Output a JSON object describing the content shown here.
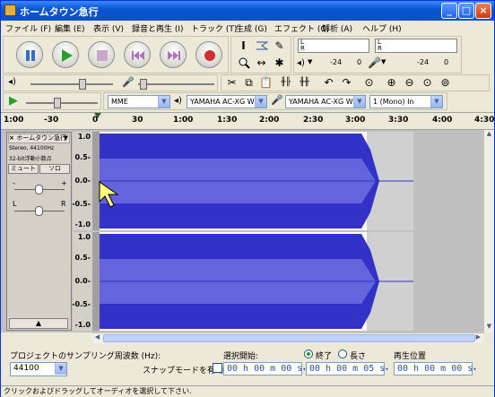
{
  "window": {
    "title": "ホームタウン急行"
  },
  "menu": [
    "ファイル (F)",
    "編集 (E)",
    "表示 (V)",
    "録音と再生 (I)",
    "トラック (T)",
    "生成 (G)",
    "エフェクト (C)",
    "解析 (A)",
    "ヘルプ (H)"
  ],
  "meters": {
    "l": "L",
    "r": "R",
    "ticks": [
      "-24",
      "0",
      "-24",
      "0"
    ]
  },
  "devices": {
    "host": "MME",
    "playback": "YAMAHA AC-XG WDI",
    "recording": "YAMAHA AC-XG WDI",
    "channels": "1 (Mono) In"
  },
  "ruler": [
    "1:00",
    "-30",
    "0",
    "30",
    "1:00",
    "1:30",
    "2:00",
    "2:30",
    "3:00",
    "3:30",
    "4:00",
    "4:30"
  ],
  "track": {
    "name": "ホームタウン急行",
    "info1": "Stereo, 44100Hz",
    "info2": "32-bit浮動小数点",
    "mute": "ミュート",
    "solo": "ソロ",
    "gain_minus": "-",
    "gain_plus": "+",
    "pan_l": "L",
    "pan_r": "R",
    "scale": [
      "1.0",
      "0.5-",
      "0.0-",
      "-0.5-",
      "-1.0",
      "1.0",
      "0.5-",
      "0.0-",
      "-0.5-",
      "-1.0"
    ]
  },
  "bottom": {
    "rate_label": "プロジェクトのサンプリング周波数 (Hz):",
    "rate_value": "44100",
    "snap_label": "スナップモードを有効",
    "sel_start_label": "選択開始:",
    "end_label": "終了",
    "length_label": "長さ",
    "pos_label": "再生位置",
    "sel_start": "00 h 00 m 00 s",
    "sel_end": "00 h 00 m 05 s",
    "position": "00 h 00 m 00 s"
  },
  "status": "クリックおよびドラッグしてオーディオを選択して下さい.",
  "colors": {
    "wave": "#3232c8",
    "wave_light": "#6464dc",
    "title": "#0a56d6"
  }
}
